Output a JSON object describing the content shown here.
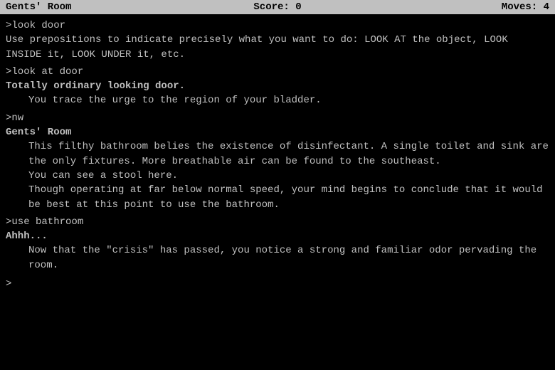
{
  "header": {
    "location": "Gents' Room",
    "score_label": "Score: 0",
    "moves_label": "Moves: 4"
  },
  "content": {
    "blocks": [
      {
        "type": "command",
        "text": ">look door"
      },
      {
        "type": "normal",
        "text": "Use prepositions to indicate precisely what you want to do: LOOK AT the object, LOOK INSIDE it, LOOK UNDER it, etc."
      },
      {
        "type": "command",
        "text": ">look at door"
      },
      {
        "type": "bold",
        "text": "Totally ordinary looking door."
      },
      {
        "type": "indented",
        "text": "You trace the urge to the region of your bladder."
      },
      {
        "type": "command",
        "text": ">nw"
      },
      {
        "type": "bold",
        "text": "Gents' Room"
      },
      {
        "type": "indented",
        "text": "This filthy bathroom belies the existence of disinfectant. A single toilet and sink are the only fixtures. More breathable air can be found to the southeast."
      },
      {
        "type": "indented",
        "text": "You can see a stool here."
      },
      {
        "type": "indented",
        "text": "Though operating at far below normal speed, your mind begins to conclude that it would be best at this point to use the bathroom."
      },
      {
        "type": "command",
        "text": ">use bathroom"
      },
      {
        "type": "bold",
        "text": "Ahhh..."
      },
      {
        "type": "indented",
        "text": "Now that the \"crisis\" has passed, you notice a strong and familiar odor pervading the room."
      },
      {
        "type": "prompt",
        "text": ">"
      }
    ]
  }
}
